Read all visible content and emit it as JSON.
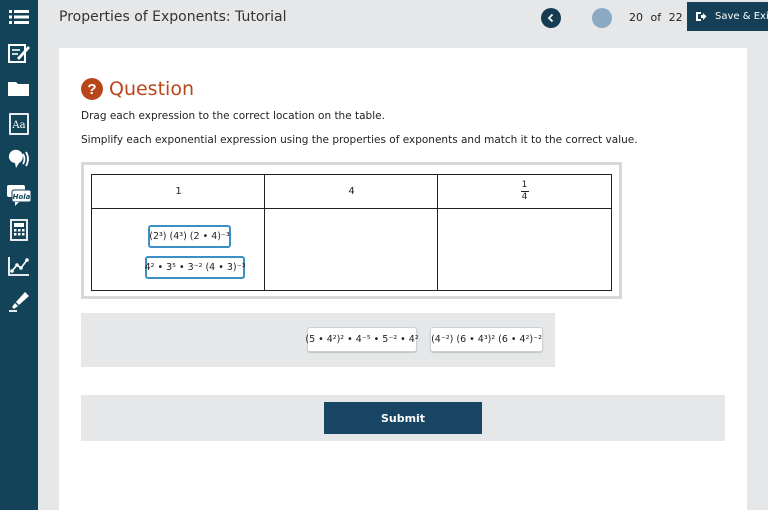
{
  "header": {
    "title": "Properties of Exponents: Tutorial",
    "current": "20",
    "of_label": "of",
    "total": "22",
    "save_exit_label": "Save & Exit"
  },
  "sidebar": {
    "tools": [
      "list-icon",
      "notes-icon",
      "folder-icon",
      "dictionary-icon",
      "audio-icon",
      "translate-icon",
      "calculator-icon",
      "graph-icon",
      "highlighter-icon"
    ],
    "translate_label": "Hola",
    "dictionary_label": "Aa"
  },
  "question": {
    "icon_label": "?",
    "title": "Question",
    "instruction_1": "Drag each expression to the correct location on the table.",
    "instruction_2": "Simplify each exponential expression using the properties of exponents and match it to the correct value."
  },
  "table": {
    "headers": [
      "1",
      "4"
    ],
    "fraction_header": {
      "numerator": "1",
      "denominator": "4"
    }
  },
  "placed_tiles": [
    "(2³) (4³) (2 • 4)⁻³",
    "4² • 3⁵ • 3⁻² (4 • 3)⁻³"
  ],
  "tray_tiles": [
    "(5 • 4²)² • 4⁻⁵ • 5⁻² • 4²",
    "(4⁻²) (6 • 4³)² (6 • 4²)⁻²"
  ],
  "submit_label": "Submit",
  "colors": {
    "sidebar": "#134358",
    "accent": "#b9451a",
    "button": "#174563",
    "tile_border": "#3b8fc4"
  }
}
